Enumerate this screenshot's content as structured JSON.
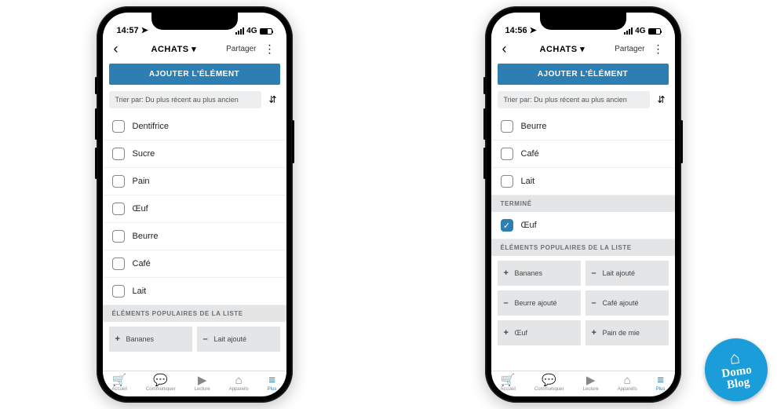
{
  "phones": [
    {
      "time": "14:57",
      "network": "4G",
      "title": "ACHATS",
      "share": "Partager",
      "addButton": "AJOUTER L'ÉLÉMENT",
      "sortLabel": "Trier par: Du plus récent au plus ancien",
      "items": [
        {
          "label": "Dentifrice",
          "done": false
        },
        {
          "label": "Sucre",
          "done": false
        },
        {
          "label": "Pain",
          "done": false
        },
        {
          "label": "Œuf",
          "done": false
        },
        {
          "label": "Beurre",
          "done": false
        },
        {
          "label": "Café",
          "done": false
        },
        {
          "label": "Lait",
          "done": false
        }
      ],
      "popularHeader": "ÉLÉMENTS POPULAIRES DE LA LISTE",
      "popular": [
        {
          "sign": "+",
          "label": "Bananes"
        },
        {
          "sign": "–",
          "label": "Lait ajouté"
        }
      ]
    },
    {
      "time": "14:56",
      "network": "4G",
      "title": "ACHATS",
      "share": "Partager",
      "addButton": "AJOUTER L'ÉLÉMENT",
      "sortLabel": "Trier par: Du plus récent au plus ancien",
      "items": [
        {
          "label": "Beurre",
          "done": false
        },
        {
          "label": "Café",
          "done": false
        },
        {
          "label": "Lait",
          "done": false
        }
      ],
      "doneHeader": "TERMINÉ",
      "doneItems": [
        {
          "label": "Œuf",
          "done": true
        }
      ],
      "popularHeader": "ÉLÉMENTS POPULAIRES DE LA LISTE",
      "popular": [
        {
          "sign": "+",
          "label": "Bananes"
        },
        {
          "sign": "–",
          "label": "Lait ajouté"
        },
        {
          "sign": "–",
          "label": "Beurre ajouté"
        },
        {
          "sign": "–",
          "label": "Café ajouté"
        },
        {
          "sign": "+",
          "label": "Œuf"
        },
        {
          "sign": "+",
          "label": "Pain de mie"
        }
      ]
    }
  ],
  "tabs": [
    {
      "icon": "🛒",
      "label": "Accueil"
    },
    {
      "icon": "💬",
      "label": "Communiquer"
    },
    {
      "icon": "▶",
      "label": "Lecture"
    },
    {
      "icon": "⌂",
      "label": "Appareils"
    },
    {
      "icon": "≡",
      "label": "Plus"
    }
  ],
  "logo": {
    "top": "Domo",
    "bottom": "Blog"
  }
}
